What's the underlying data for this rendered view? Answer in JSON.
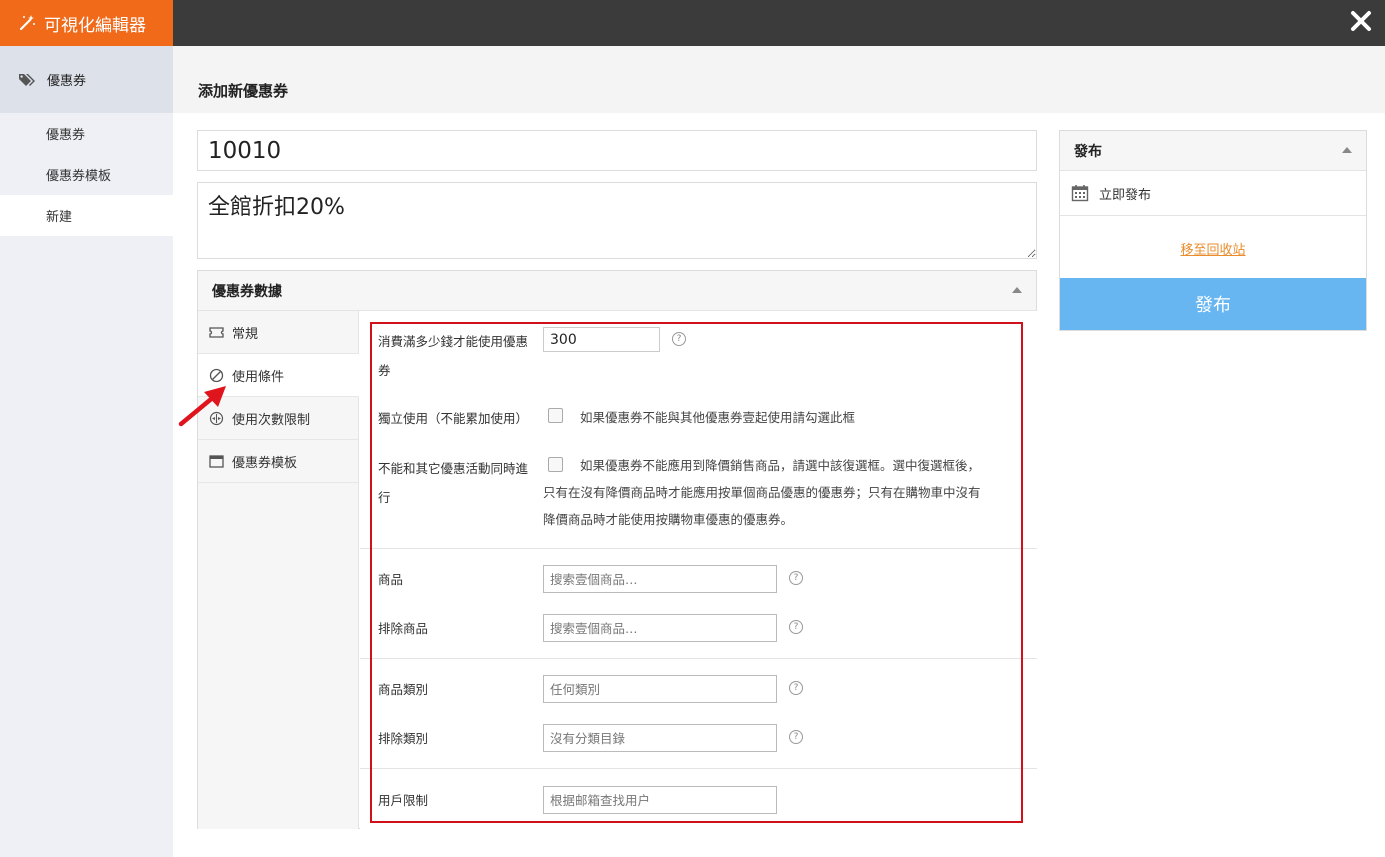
{
  "app": {
    "title": "可視化編輯器"
  },
  "sidebar": {
    "header": "優惠券",
    "items": [
      {
        "label": "優惠券"
      },
      {
        "label": "優惠券模板"
      },
      {
        "label": "新建"
      }
    ]
  },
  "page": {
    "title": "添加新優惠券"
  },
  "coupon": {
    "code": "10010",
    "description": "全館折扣20%"
  },
  "data_box": {
    "title": "優惠券數據",
    "tabs": [
      {
        "label": "常規"
      },
      {
        "label": "使用條件"
      },
      {
        "label": "使用次數限制"
      },
      {
        "label": "優惠券模板"
      }
    ]
  },
  "conditions": {
    "min_spend": {
      "label_line1": "消費滿多少錢才能使用優惠",
      "label_line2": "券",
      "value": "300"
    },
    "individual_use": {
      "label": "獨立使用（不能累加使用）",
      "description": "如果優惠券不能與其他優惠券壹起使用請勾選此框"
    },
    "exclude_sale": {
      "label_line1": "不能和其它優惠活動同時進",
      "label_line2": "行",
      "desc_line1": "如果優惠券不能應用到降價銷售商品，請選中該復選框。選中復選框後，",
      "desc_line2": "只有在沒有降價商品時才能應用按單個商品優惠的優惠券；只有在購物車中沒有",
      "desc_line3": "降價商品時才能使用按購物車優惠的優惠券。"
    },
    "products": {
      "label": "商品",
      "placeholder": "搜索壹個商品…"
    },
    "exclude_products": {
      "label": "排除商品",
      "placeholder": "搜索壹個商品…"
    },
    "product_categories": {
      "label": "商品類別",
      "placeholder": "任何類別"
    },
    "exclude_categories": {
      "label": "排除類別",
      "placeholder": "沒有分類目錄"
    },
    "user_restriction": {
      "label": "用戶限制",
      "placeholder": "根据邮箱查找用户"
    },
    "help_glyph": "?"
  },
  "publish": {
    "title": "發布",
    "schedule": "立即發布",
    "trash_link": "移至回收站",
    "button": "發布"
  },
  "colors": {
    "brand": "#f06a1a",
    "topbar": "#3b3b3b",
    "publish_button": "#67b6f2",
    "annotation": "#d0111a",
    "trash_link": "#e98c2c"
  }
}
